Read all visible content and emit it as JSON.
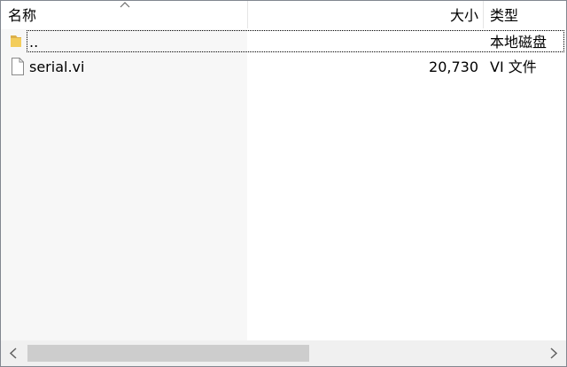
{
  "columns": {
    "name_label": "名称",
    "size_label": "大小",
    "type_label": "类型"
  },
  "sort": {
    "column": "名称",
    "indicator_icon": "sort-up-chevron-icon"
  },
  "rows": [
    {
      "icon": "folder-icon",
      "name": "..",
      "size": "",
      "type": "本地磁盘",
      "focused": true
    },
    {
      "icon": "file-icon",
      "name": "serial.vi",
      "size": "20,730",
      "type": "VI 文件",
      "focused": false
    }
  ],
  "scrollbar": {
    "left_icon": "arrow-left-icon",
    "right_icon": "arrow-right-icon",
    "visible_fraction": 0.55
  },
  "colors": {
    "border": "#828790",
    "sorted_column_bg": "#f7f7f7",
    "folder": "#dcb04a",
    "scrollbar_bg": "#f0f0f0",
    "scrollbar_thumb": "#cdcdcd"
  }
}
